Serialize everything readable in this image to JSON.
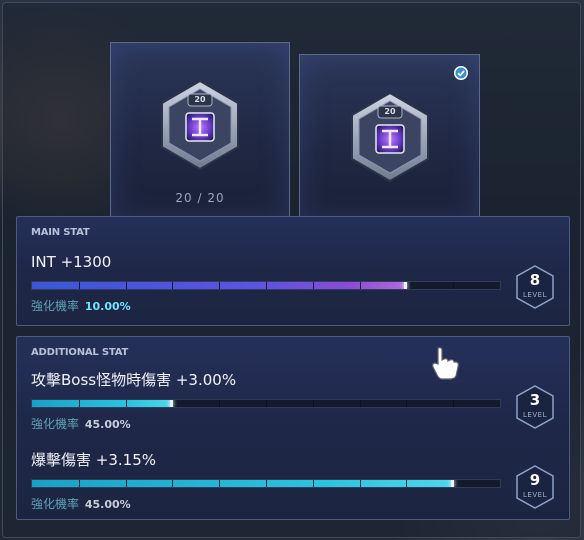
{
  "slots": [
    {
      "badge_level": "20",
      "count_text": "20 / 20",
      "selected": false
    },
    {
      "badge_level": "20",
      "selected": true
    }
  ],
  "main_stat": {
    "title": "MAIN STAT",
    "stat": "INT +1300",
    "rate_label": "強化機率",
    "rate_value": "10.00%",
    "progress": 0.8,
    "level": "8",
    "level_label": "LEVEL"
  },
  "additional_stat": {
    "title": "ADDITIONAL STAT",
    "stats": [
      {
        "stat": "攻擊Boss怪物時傷害 +3.00%",
        "rate_label": "強化機率",
        "rate_value": "45.00%",
        "progress": 0.3,
        "level": "3",
        "level_label": "LEVEL"
      },
      {
        "stat": "爆擊傷害 +3.15%",
        "rate_label": "強化機率",
        "rate_value": "45.00%",
        "progress": 0.9,
        "level": "9",
        "level_label": "LEVEL"
      }
    ]
  },
  "colors": {
    "main_fill": "#5b54e0",
    "additional_fill": "#2bc4df",
    "check": "#4fc3f7"
  },
  "icons": [
    "hexagon-gem-icon",
    "check-circle-icon",
    "pointer-hand-icon"
  ]
}
